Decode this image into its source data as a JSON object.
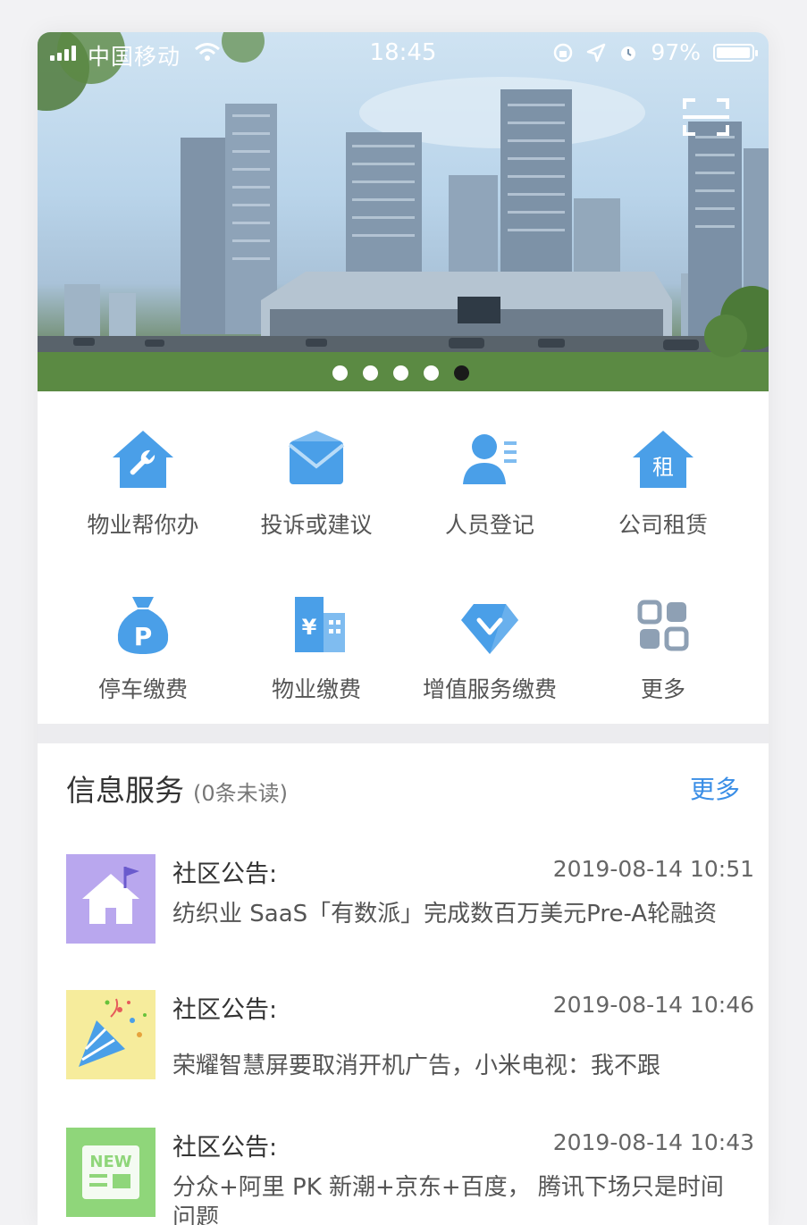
{
  "status_bar": {
    "carrier": "中国移动",
    "time": "18:45",
    "battery": "97%",
    "battery_level": 0.97
  },
  "banner": {
    "slide_count": 5,
    "active_index": 4,
    "scan_icon": "scan-icon"
  },
  "services": [
    {
      "label": "物业帮你办",
      "icon": "house-wrench-icon"
    },
    {
      "label": "投诉或建议",
      "icon": "envelope-icon"
    },
    {
      "label": "人员登记",
      "icon": "person-list-icon"
    },
    {
      "label": "公司租赁",
      "icon": "house-rent-icon",
      "glyph": "租"
    },
    {
      "label": "停车缴费",
      "icon": "parking-bag-icon",
      "glyph": "P"
    },
    {
      "label": "物业缴费",
      "icon": "building-yen-icon",
      "glyph": "¥"
    },
    {
      "label": "增值服务缴费",
      "icon": "diamond-check-icon"
    },
    {
      "label": "更多",
      "icon": "grid-more-icon"
    }
  ],
  "info": {
    "title": "信息服务",
    "unread": "(0条未读)",
    "more": "更多",
    "items": [
      {
        "tag": "社区公告:",
        "date": "2019-08-14 10:51",
        "title": "纺织业 SaaS「有数派」完成数百万美元Pre-A轮融资",
        "thumb": "house-flag-icon"
      },
      {
        "tag": "社区公告:",
        "date": "2019-08-14 10:46",
        "title": "荣耀智慧屏要取消开机广告，小米电视：我不跟",
        "thumb": "party-popper-icon"
      },
      {
        "tag": "社区公告:",
        "date": "2019-08-14 10:43",
        "title": "分众+阿里 PK 新潮+京东+百度， 腾讯下场只是时间问题",
        "thumb": "new-badge-icon",
        "thumb_text": "NEW"
      }
    ]
  },
  "colors": {
    "accent": "#3a8ee6",
    "icon_blue": "#4a9fe8",
    "thumb_purple": "#b9a7ee",
    "thumb_yellow": "#f6ec9c",
    "thumb_green": "#8fd67a"
  }
}
